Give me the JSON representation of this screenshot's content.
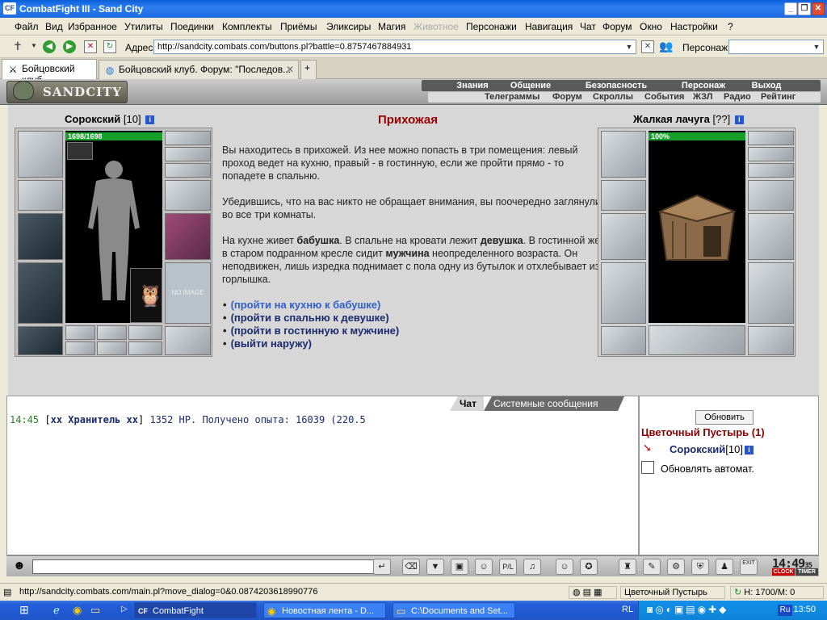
{
  "window": {
    "title": "CombatFight III - Sand City",
    "logo": "CF"
  },
  "menu": [
    "Файл",
    "Вид",
    "Избранное",
    "Утилиты",
    "Поединки",
    "Комплекты",
    "Приёмы",
    "Эликсиры",
    "Магия",
    "Животное",
    "Персонажи",
    "Навигация",
    "Чат",
    "Форум",
    "Окно",
    "Настройки",
    "?"
  ],
  "address": {
    "label": "Адрес:",
    "url": "http://sandcity.combats.com/buttons.pl?battle=0.8757467884931",
    "persona_label": "Персонаж:"
  },
  "tabs": [
    {
      "label": "Бойцовский клуб"
    },
    {
      "label": "Бойцовский клуб. Форум: \"Последов..."
    }
  ],
  "game": {
    "logo": "SANDCITY",
    "nav_top": [
      "Знания",
      "Общение",
      "Безопасность",
      "Персонаж",
      "Выход"
    ],
    "nav_bottom": [
      "Телеграммы",
      "Форум",
      "Скроллы",
      "События",
      "ЖЗЛ",
      "Радио",
      "Рейтинг"
    ]
  },
  "player": {
    "name": "Сорокский",
    "level": "[10]",
    "hp": "1698/1698",
    "hp_fraction": 1.0
  },
  "enemy": {
    "name": "Жалкая лачуга",
    "level": "[??]",
    "hp": "100%",
    "hp_fraction": 1.0
  },
  "no_image": "NO IMAGE",
  "room": {
    "title": "Прихожая",
    "p1": "Вы находитесь в прихожей. Из нее можно попасть в три помещения: левый проход ведет на кухню, правый - в гостинную, если же пройти прямо - то попадете в спальню.",
    "p2": "Убедившись, что на вас никто не обращает внимания, вы поочередно заглянули во все три комнаты.",
    "p3_a": "На кухне живет ",
    "p3_b": "бабушка",
    "p3_c": ". В спальне на кровати лежит ",
    "p3_d": "девушка",
    "p3_e": ". В гостинной же в старом подранном кресле сидит ",
    "p3_f": "мужчина",
    "p3_g": " неопределенного возраста. Он неподвижен, лишь изредка поднимает с пола одну из бутылок и отхлебывает из горлышка.",
    "choices": [
      "(пройти на кухню к бабушке)",
      "(пройти в спальню к девушке)",
      "(пройти в гостинную к мужчине)",
      "(выйти наружу)"
    ]
  },
  "chat": {
    "tabs": [
      "Чат",
      "Системные сообщения"
    ],
    "line": {
      "time": "14:45",
      "name": "xx Хранитель xx",
      "text": "1352 HP. Получено опыта: 16039 (220.5"
    }
  },
  "right_panel": {
    "refresh": "Обновить",
    "location": "Цветочный Пустырь (1)",
    "player_name": "Сорокский",
    "player_level": "[10]",
    "auto_refresh": "Обновлять автомат."
  },
  "clock": {
    "time": "14:49",
    "seconds": "35",
    "clock_label": "CLOCK",
    "timer_label": "TIMER",
    "exit_label": "EXIT"
  },
  "status": {
    "url": "http://sandcity.combats.com/main.pl?move_dialog=0&0.0874203618990776",
    "location": "Цветочный Пустырь",
    "hp": "H: 1700/M: 0"
  },
  "taskbar": {
    "items": [
      "CombatFight",
      "Новостная лента - D...",
      "C:\\Documents and Set..."
    ],
    "lang": "RL",
    "ru": "Ru",
    "time": "13:50"
  }
}
